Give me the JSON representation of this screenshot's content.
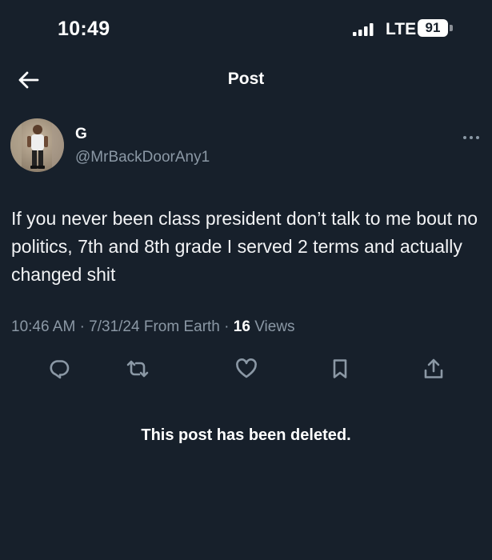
{
  "status_bar": {
    "time": "10:49",
    "network": "LTE",
    "battery": "91"
  },
  "header": {
    "title": "Post"
  },
  "post": {
    "author_name": "G",
    "author_handle": "@MrBackDoorAny1",
    "text": "If you never been class president don’t talk to me bout no politics, 7th and 8th grade I served 2 terms and actually changed shit",
    "time": "10:46 AM",
    "date": "7/31/24",
    "source": "From Earth",
    "views_count": "16",
    "views_label": "Views"
  },
  "notice": "This post has been deleted.",
  "colors": {
    "background": "#17202b",
    "secondary_text": "#8b98a5",
    "icon": "#8b98a5"
  },
  "icons": [
    "signal-icon",
    "battery-icon",
    "back-arrow-icon",
    "more-icon",
    "reply-icon",
    "repost-icon",
    "like-icon",
    "bookmark-icon",
    "share-icon"
  ]
}
